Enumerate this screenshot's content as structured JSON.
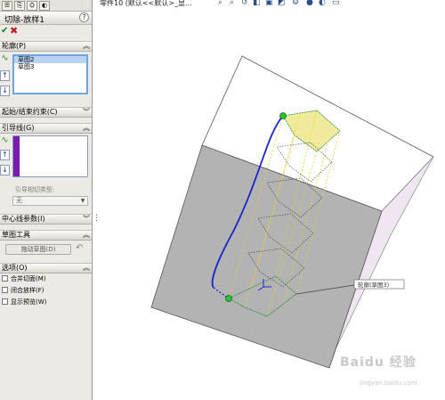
{
  "panel": {
    "tabs": [
      "☰",
      "⎘",
      "⛭",
      "◐"
    ],
    "feature_title": "切除-放样1",
    "help_label": "?",
    "sections": {
      "profiles": "轮廓(P)",
      "start_end": "起始/结束约束(C)",
      "guides": "引导线(G)",
      "centerline": "中心线参数(I)",
      "sketch_tools": "草图工具",
      "options": "选项(O)"
    },
    "profiles_list": [
      "草图2",
      "草图3"
    ],
    "guide_tangency_label": "引导相切类型:",
    "guide_tangency_value": "无",
    "drag_sketch_label": "拖动草图(D)",
    "options_items": [
      "合并切面(M)",
      "闭合放样(F)",
      "显示预览(W)"
    ]
  },
  "toolbar": {
    "tree_item": "零件10  (默认<<默认>_显..."
  },
  "viewport": {
    "callout_label": "轮廓(草图3)",
    "colors": {
      "top_face": "#ffffff",
      "front_face": "#b3b3b3",
      "side_face": "#efe6f2",
      "guide_curve": "#1728c8",
      "profile_fill": "#f0eb9a",
      "point_green": "#2fbf3a"
    }
  },
  "watermark": {
    "brand": "Baidu 经验",
    "url": "jingyan.baidu.com"
  }
}
